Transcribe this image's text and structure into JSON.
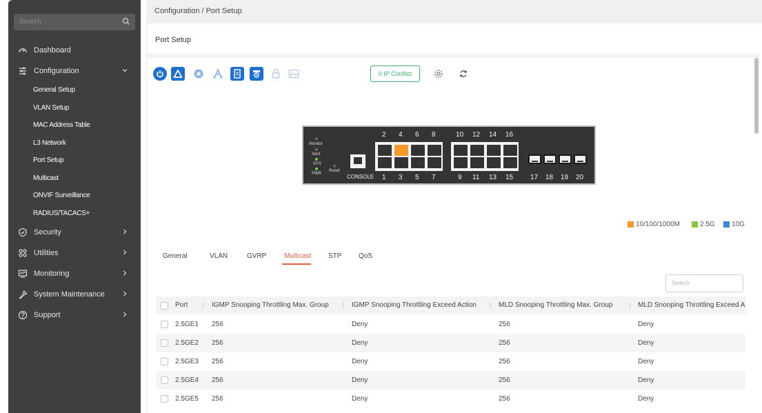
{
  "sidebar": {
    "search_placeholder": "Search",
    "items": [
      {
        "label": "Dashboard",
        "icon": "dashboard-icon"
      },
      {
        "label": "Configuration",
        "icon": "sliders-icon",
        "expanded": true
      },
      {
        "label": "Security",
        "icon": "shield-icon"
      },
      {
        "label": "Utilities",
        "icon": "grid-icon"
      },
      {
        "label": "Monitoring",
        "icon": "monitor-icon"
      },
      {
        "label": "System Maintenance",
        "icon": "wrench-icon"
      },
      {
        "label": "Support",
        "icon": "help-icon"
      }
    ],
    "sub_items": [
      "General Setup",
      "VLAN Setup",
      "MAC Address Table",
      "L3 Network",
      "Port Setup",
      "Multicast",
      "ONVIF Surveillance",
      "RADIUS/TACACS+"
    ]
  },
  "breadcrumb": "Configuration / Port Setup",
  "page_title": "Port Setup",
  "toolbar": {
    "ip_conflict_label": "0 IP Conflict"
  },
  "device": {
    "led_labels": [
      "Monitor",
      "Alert",
      "SYS",
      "PWR"
    ],
    "reset_label": "Reset",
    "console_label": "CONSOLE",
    "top_numbers": [
      "2",
      "4",
      "6",
      "8",
      "10",
      "12",
      "14",
      "16"
    ],
    "bottom_numbers": [
      "1",
      "3",
      "5",
      "7",
      "9",
      "11",
      "13",
      "15",
      "17",
      "18",
      "19",
      "20"
    ],
    "active_port": "4"
  },
  "legend": [
    {
      "label": "10/100/1000M",
      "color": "#f39a2b"
    },
    {
      "label": "2.5G",
      "color": "#8dc63f"
    },
    {
      "label": "10G",
      "color": "#3b86d6"
    }
  ],
  "tabs": [
    "General",
    "VLAN",
    "GVRP",
    "Multicast",
    "STP",
    "QoS"
  ],
  "active_tab": "Multicast",
  "table": {
    "search_placeholder": "Search",
    "headers": [
      "Port",
      "IGMP Snooping Throttling Max. Group",
      "IGMP Snooping Throttling Exceed Action",
      "MLD Snooping Throttling Max. Group",
      "MLD Snooping Throttling Exceed A"
    ],
    "rows": [
      [
        "2.5GE1",
        "256",
        "Deny",
        "256",
        "Deny"
      ],
      [
        "2.5GE2",
        "256",
        "Deny",
        "256",
        "Deny"
      ],
      [
        "2.5GE3",
        "256",
        "Deny",
        "256",
        "Deny"
      ],
      [
        "2.5GE4",
        "256",
        "Deny",
        "256",
        "Deny"
      ],
      [
        "2.5GE5",
        "256",
        "Deny",
        "256",
        "Deny"
      ]
    ]
  }
}
